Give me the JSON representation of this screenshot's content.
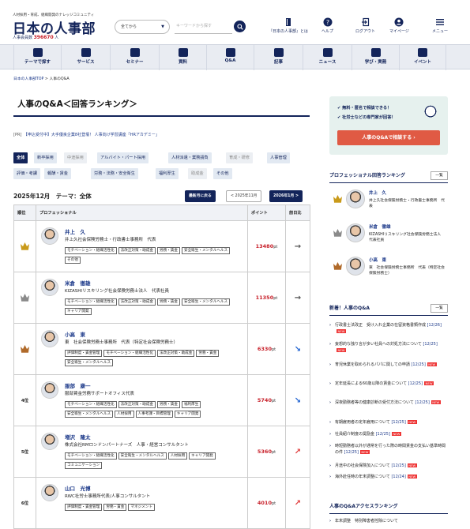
{
  "header": {
    "tagline": "人材採用・育成、組織開発のナレッジコミュニティ",
    "logo": "日本の人事部",
    "members_label": "人事",
    "members_count": "396670",
    "members_suffix": "人",
    "scope_select": "全てから",
    "search_placeholder": "キーワードから探す",
    "links": [
      "『日本の人事部』とは",
      "ヘルプ",
      "ログアウト",
      "マイページ",
      "メニュー"
    ]
  },
  "gnav": [
    "テーマで探す",
    "サービス",
    "セミナー",
    "資料",
    "Q&A",
    "記事",
    "ニュース",
    "学び・実務",
    "イベント"
  ],
  "breadcrumb": {
    "home": "日本の人事部TOP",
    "sep": ">",
    "current": "人事のQ&A"
  },
  "page_title": "人事のQ&A＜回答ランキング＞",
  "pr": {
    "prefix": "[PR]",
    "text": "【申込受付中】大手優良企業8社登壇！ 人事向け学習講座「HRアカデミー」"
  },
  "filters": [
    {
      "label": "全体",
      "state": "selected"
    },
    {
      "label": "新卒採用",
      "state": "normal"
    },
    {
      "label": "中途採用",
      "state": "dim"
    },
    {
      "label": "アルバイト・パート採用",
      "state": "normal"
    },
    {
      "label": "人材派遣・業務請負",
      "state": "normal"
    },
    {
      "label": "育成・研修",
      "state": "dim"
    },
    {
      "label": "人事管理",
      "state": "normal"
    },
    {
      "label": "評価・考課",
      "state": "normal"
    },
    {
      "label": "報酬・賃金",
      "state": "normal"
    },
    {
      "label": "労務・法務・安全衛生",
      "state": "normal"
    },
    {
      "label": "福利厚生",
      "state": "normal"
    },
    {
      "label": "助成金",
      "state": "dim"
    },
    {
      "label": "その他",
      "state": "normal"
    }
  ],
  "month_heading": "2025年12月　テーマ：全体",
  "month_buttons": {
    "latest": "最新月に戻る",
    "prev": "< 2025年11月",
    "next": "2026年1月 >"
  },
  "table": {
    "headers": [
      "順位",
      "プロフェッショナル",
      "ポイント",
      "前日比"
    ],
    "rows": [
      {
        "rank": "1",
        "name": "井上　久",
        "org": "井上久社会保険労務士・行政書士事務所　代表",
        "tags": [
          "モチベーション・組織活性化",
          "法改正対策・助成金",
          "労務・賃金",
          "安全衛生・メンタルヘルス",
          "その他"
        ],
        "points": "13480",
        "unit": "pt",
        "trend": "→"
      },
      {
        "rank": "2",
        "name": "米倉　徹雄",
        "org": "KIZASHIリスキリング社会保険労務士法人　代表社員",
        "tags": [
          "モチベーション・組織活性化",
          "法改正対策・助成金",
          "労務・賃金",
          "安全衛生・メンタルヘルス",
          "キャリア開発"
        ],
        "points": "11350",
        "unit": "pt",
        "trend": "→"
      },
      {
        "rank": "3",
        "name": "小高　東",
        "org": "東　社会保険労務士事務所　代表（特定社会保険労務士）",
        "tags": [
          "評価制度・賃金管理",
          "モチベーション・組織活性化",
          "法改正対策・助成金",
          "労務・賃金",
          "安全衛生・メンタルヘルス"
        ],
        "points": "6330",
        "unit": "pt",
        "trend": "↘"
      },
      {
        "rank": "4位",
        "name": "服部　康一",
        "org": "服部賃金労務サポートオフィス代表",
        "tags": [
          "モチベーション・組織活性化",
          "法改正対策・助成金",
          "労務・賃金",
          "福利厚生",
          "安全衛生・メンタルヘルス",
          "人材採用",
          "人事考課・目標管理",
          "キャリア開発"
        ],
        "points": "5740",
        "unit": "pt",
        "trend": "↘"
      },
      {
        "rank": "5位",
        "name": "増沢　隆太",
        "org": "株式会社RMロンドンパートナーズ　人事・経営コンサルタント",
        "tags": [
          "モチベーション・組織活性化",
          "安全衛生・メンタルヘルス",
          "人材採用",
          "キャリア開発",
          "コミュニケーション"
        ],
        "points": "5360",
        "unit": "pt",
        "trend": "↗"
      },
      {
        "rank": "6位",
        "name": "山口　光博",
        "org": "RWC社労士事務所代表/人事コンサルタント",
        "tags": [
          "評価制度・賃金管理",
          "労務・賃金",
          "マネジメント"
        ],
        "points": "4010",
        "unit": "pt",
        "trend": "↗"
      }
    ]
  },
  "cta": {
    "line1": "無料・匿名で相談できる！",
    "line2": "社労士などの専門家が回答！",
    "button": "人事のQ&Aで相談する"
  },
  "sidebar_ranking": {
    "title": "プロフェッショナル回答ランキング",
    "more": "一覧",
    "items": [
      {
        "name": "井上　久",
        "org": "井上久社会保険労務士・行政書士事務所　代表"
      },
      {
        "name": "米倉　徹雄",
        "org": "KIZASHIリスキリング社会保険労務士法人　代表社員"
      },
      {
        "name": "小高　東",
        "org": "東　社会保険労務士事務所　代表（特定社会保険労務士）"
      }
    ]
  },
  "sidebar_news": {
    "title": "新着！人事のQ&A",
    "more": "一覧",
    "items": [
      {
        "text": "行政書士法改正　受け入れ企業の在留資格書類作成",
        "date": "[12/26]",
        "new": "NEW"
      },
      {
        "text": "妄想的な独り言が多い社員への対処方法について",
        "date": "[12/25]",
        "new": "NEW"
      },
      {
        "text": "育児休業を取められるパパに関しての申請",
        "date": "[12/25]",
        "new": "NEW"
      },
      {
        "text": "定年延長による60歳以降の賃金について",
        "date": "[12/25]",
        "new": "NEW"
      },
      {
        "text": "深夜勤務者等の健康診断の受付方法について",
        "date": "[12/25]",
        "new": "NEW"
      },
      {
        "text": "有期雇用者の定年雇用について",
        "date": "[12/25]",
        "new": "NEW"
      },
      {
        "text": "社員紹介制度の奨励金",
        "date": "[12/25]",
        "new": "NEW"
      },
      {
        "text": "時短勤務者以外が通常を行った際の時間賃金の支払い基準時間の件",
        "date": "[12/25]",
        "new": "NEW"
      },
      {
        "text": "月途中の社会保険加入について",
        "date": "[12/25]",
        "new": "NEW"
      },
      {
        "text": "海外赴任時の年末調整について",
        "date": "[12/24]",
        "new": "NEW"
      }
    ]
  },
  "sidebar_access": {
    "title": "人事のQ&Aアクセスランキング",
    "first_item": "年末調整　特別障害者控除について"
  },
  "colors": {
    "navy": "#13245a",
    "link": "#1d3a8a",
    "points": "#c8202a",
    "cta": "#e05a44",
    "gold": "#c99a1a",
    "silver": "#8a8a8a",
    "bronze": "#b06a2a"
  }
}
